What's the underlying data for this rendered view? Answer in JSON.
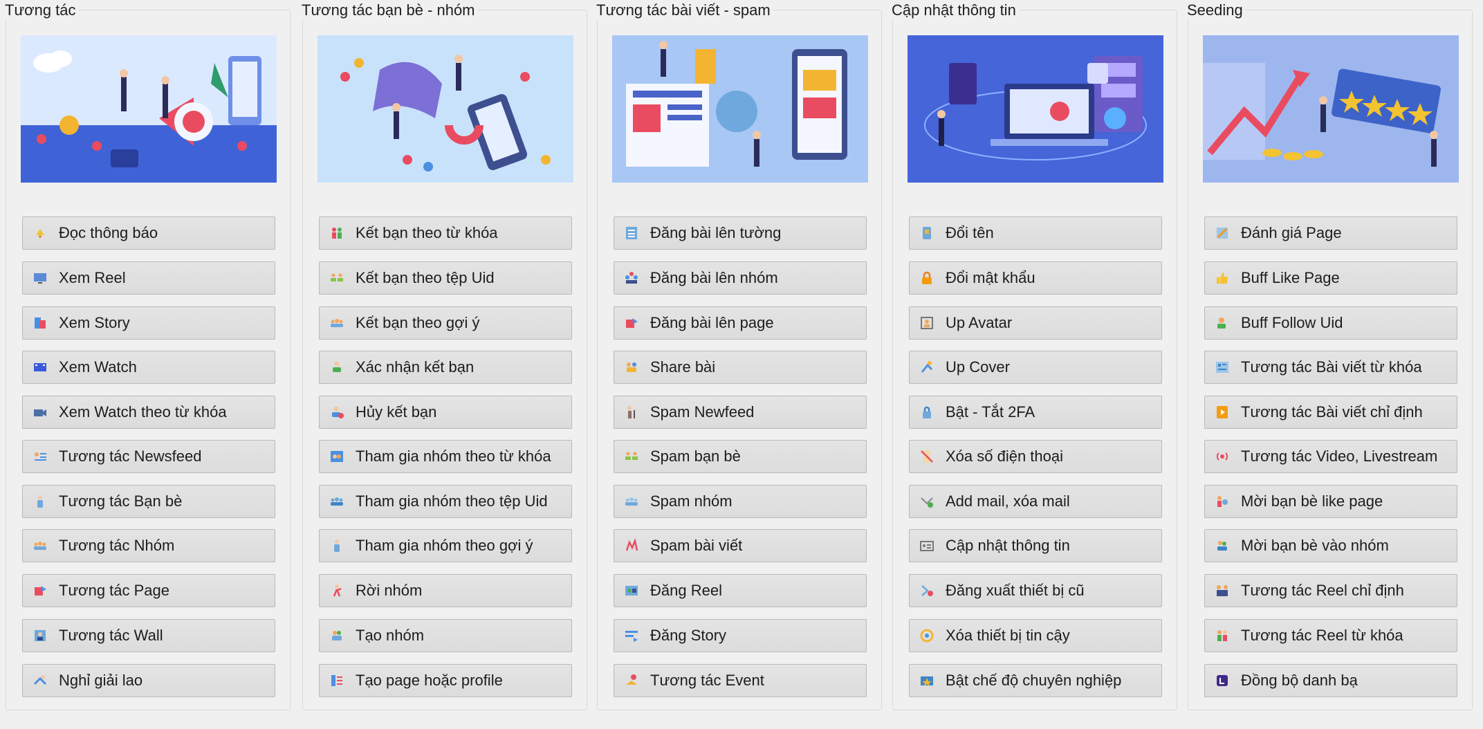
{
  "groups": [
    {
      "title": "Tương tác",
      "buttons": [
        {
          "label": "Đọc thông báo",
          "icon": "bell-icon"
        },
        {
          "label": "Xem Reel",
          "icon": "monitor-icon"
        },
        {
          "label": "Xem Story",
          "icon": "story-icon"
        },
        {
          "label": "Xem Watch",
          "icon": "film-icon"
        },
        {
          "label": "Xem Watch theo từ khóa",
          "icon": "camera-icon"
        },
        {
          "label": "Tương tác Newsfeed",
          "icon": "newsfeed-icon"
        },
        {
          "label": "Tương tác Bạn bè",
          "icon": "person-icon"
        },
        {
          "label": "Tương tác Nhóm",
          "icon": "group-icon"
        },
        {
          "label": "Tương tác Page",
          "icon": "page-icon"
        },
        {
          "label": "Tương tác Wall",
          "icon": "wall-icon"
        },
        {
          "label": "Nghỉ giải lao",
          "icon": "rest-icon"
        }
      ]
    },
    {
      "title": "Tương tác bạn bè - nhóm",
      "buttons": [
        {
          "label": "Kết bạn theo từ khóa",
          "icon": "people-icon"
        },
        {
          "label": "Kết bạn theo tệp Uid",
          "icon": "people-list-icon"
        },
        {
          "label": "Kết bạn theo gợi ý",
          "icon": "group-icon"
        },
        {
          "label": "Xác nhận kết bạn",
          "icon": "confirm-user-icon"
        },
        {
          "label": "Hủy kết bạn",
          "icon": "remove-user-icon"
        },
        {
          "label": "Tham gia nhóm theo từ khóa",
          "icon": "join-group-icon"
        },
        {
          "label": "Tham gia nhóm theo tệp Uid",
          "icon": "group-icon"
        },
        {
          "label": "Tham gia nhóm theo gợi ý",
          "icon": "person-icon"
        },
        {
          "label": "Rời nhóm",
          "icon": "leave-icon"
        },
        {
          "label": "Tạo nhóm",
          "icon": "create-group-icon"
        },
        {
          "label": "Tạo page hoặc profile",
          "icon": "profile-icon"
        }
      ]
    },
    {
      "title": "Tương tác bài viết - spam",
      "buttons": [
        {
          "label": "Đăng bài lên tường",
          "icon": "post-icon"
        },
        {
          "label": "Đăng bài lên nhóm",
          "icon": "group-post-icon"
        },
        {
          "label": "Đăng bài lên page",
          "icon": "page-icon"
        },
        {
          "label": "Share bài",
          "icon": "share-icon"
        },
        {
          "label": "Spam Newfeed",
          "icon": "spam-feed-icon"
        },
        {
          "label": "Spam bạn bè",
          "icon": "people-list-icon"
        },
        {
          "label": "Spam nhóm",
          "icon": "spam-group-icon"
        },
        {
          "label": "Spam bài viết",
          "icon": "spam-post-icon"
        },
        {
          "label": "Đăng Reel",
          "icon": "reel-icon"
        },
        {
          "label": "Đăng Story",
          "icon": "story-post-icon"
        },
        {
          "label": "Tương tác Event",
          "icon": "event-icon"
        }
      ]
    },
    {
      "title": "Cập nhật thông tin",
      "buttons": [
        {
          "label": "Đổi tên",
          "icon": "rename-icon"
        },
        {
          "label": "Đổi mật khẩu",
          "icon": "lock-icon"
        },
        {
          "label": "Up Avatar",
          "icon": "avatar-icon"
        },
        {
          "label": "Up Cover",
          "icon": "cover-icon"
        },
        {
          "label": "Bật - Tắt 2FA",
          "icon": "padlock-icon"
        },
        {
          "label": "Xóa số điện thoại",
          "icon": "no-phone-icon"
        },
        {
          "label": "Add mail, xóa mail",
          "icon": "mail-icon"
        },
        {
          "label": "Cập nhật thông tin",
          "icon": "id-card-icon"
        },
        {
          "label": "Đăng xuất thiết bị cũ",
          "icon": "logout-icon"
        },
        {
          "label": "Xóa thiết bị tin cậy",
          "icon": "device-icon"
        },
        {
          "label": "Bật chế độ chuyên nghiệp",
          "icon": "pro-icon"
        }
      ]
    },
    {
      "title": "Seeding",
      "buttons": [
        {
          "label": "Đánh giá Page",
          "icon": "rate-icon"
        },
        {
          "label": "Buff Like Page",
          "icon": "like-icon"
        },
        {
          "label": "Buff Follow Uid",
          "icon": "follow-icon"
        },
        {
          "label": "Tương tác Bài viết từ khóa",
          "icon": "keyword-post-icon"
        },
        {
          "label": "Tương tác Bài viết chỉ định",
          "icon": "play-icon"
        },
        {
          "label": "Tương tác Video, Livestream",
          "icon": "live-icon"
        },
        {
          "label": "Mời bạn bè like page",
          "icon": "invite-like-icon"
        },
        {
          "label": "Mời bạn bè vào nhóm",
          "icon": "invite-group-icon"
        },
        {
          "label": "Tương tác Reel chỉ định",
          "icon": "reel-people-icon"
        },
        {
          "label": "Tương tác Reel từ khóa",
          "icon": "reel-keyword-icon"
        },
        {
          "label": "Đồng bộ danh bạ",
          "icon": "contacts-icon"
        }
      ]
    }
  ]
}
